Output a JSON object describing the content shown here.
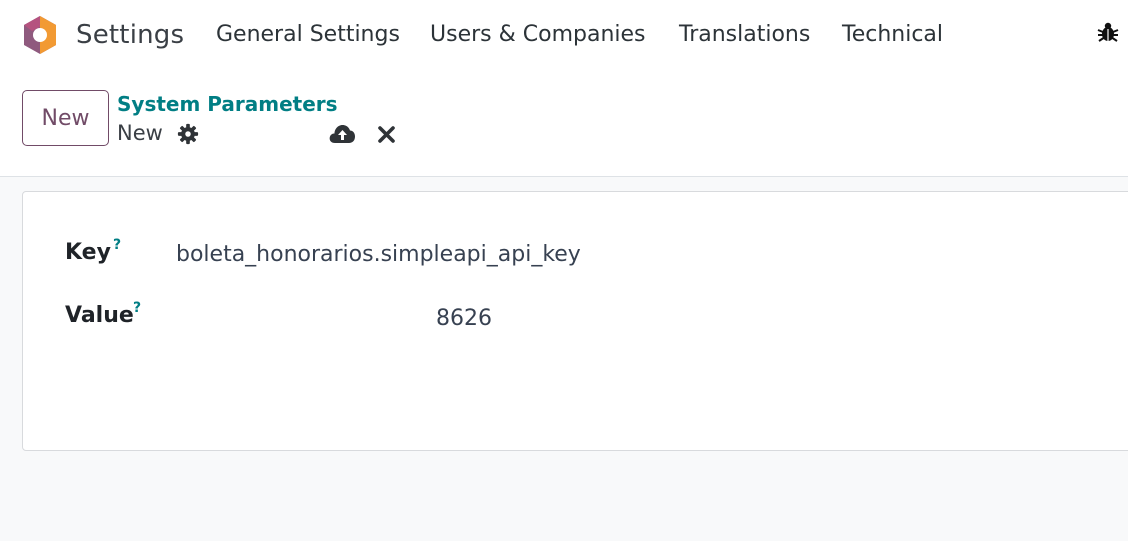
{
  "navbar": {
    "app_name": "Settings",
    "menu": [
      "General Settings",
      "Users & Companies",
      "Translations",
      "Technical"
    ],
    "logo_colors": {
      "outer": "#c46a8e",
      "orange": "#f2a33a",
      "purple": "#714b67"
    },
    "debug_icon": "bug-icon"
  },
  "control_panel": {
    "new_label": "New",
    "breadcrumb": "System Parameters",
    "record_name": "New",
    "icons": [
      "gear-icon",
      "cloud-upload-icon",
      "close-icon"
    ],
    "accent_color": "#714b67",
    "link_color": "#017e84"
  },
  "form": {
    "key_label": "Key",
    "key_help": "?",
    "key_value": "boleta_honorarios.simpleapi_api_key",
    "value_label": "Value",
    "value_help": "?",
    "value_value": "8626"
  }
}
